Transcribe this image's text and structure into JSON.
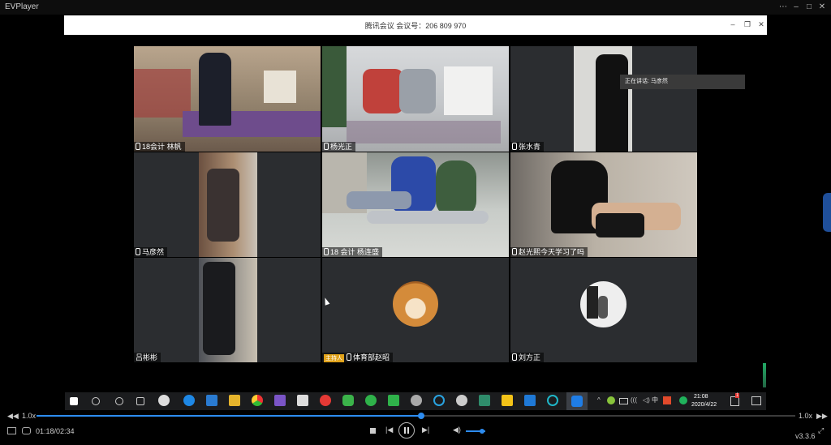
{
  "player": {
    "title": "EVPlayer",
    "speed_left": "1.0x",
    "speed_right": "1.0x",
    "time": "01:18/02:34",
    "progress": 0.507,
    "volume": 0.6,
    "version": "v3.3.6"
  },
  "meeting": {
    "title": "腾讯会议 会议号：206 809 970",
    "speaker_popup": "正在讲话: 马彦然",
    "host_tag": "主持人"
  },
  "participants": [
    {
      "name": "18会计 林帆",
      "mic": true
    },
    {
      "name": "杨光正",
      "mic": true
    },
    {
      "name": "张水青",
      "mic": true
    },
    {
      "name": "马彦然",
      "mic": true
    },
    {
      "name": "18 会计 杨连盛",
      "mic": true
    },
    {
      "name": "赵光熙今天学习了吗",
      "mic": true
    },
    {
      "name": "吕彬彬",
      "mic": false
    },
    {
      "name": "体育部赵昭",
      "mic": true,
      "host": true
    },
    {
      "name": "刘方正",
      "mic": true
    }
  ],
  "taskbar": {
    "clock_time": "21:08",
    "clock_date": "2020/4/22",
    "ime": "中",
    "notification_count": "1"
  },
  "colors": {
    "accent": "#2d8cf0",
    "host_tag": "#e0a21a",
    "tile_bg": "#2b2d30"
  }
}
